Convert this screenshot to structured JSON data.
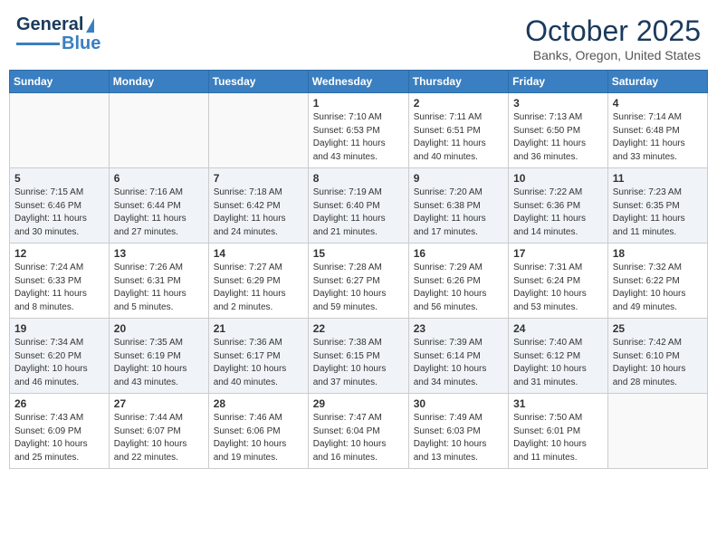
{
  "header": {
    "logo_line1": "General",
    "logo_line2": "Blue",
    "month": "October 2025",
    "location": "Banks, Oregon, United States"
  },
  "weekdays": [
    "Sunday",
    "Monday",
    "Tuesday",
    "Wednesday",
    "Thursday",
    "Friday",
    "Saturday"
  ],
  "weeks": [
    [
      {
        "day": "",
        "info": ""
      },
      {
        "day": "",
        "info": ""
      },
      {
        "day": "",
        "info": ""
      },
      {
        "day": "1",
        "info": "Sunrise: 7:10 AM\nSunset: 6:53 PM\nDaylight: 11 hours\nand 43 minutes."
      },
      {
        "day": "2",
        "info": "Sunrise: 7:11 AM\nSunset: 6:51 PM\nDaylight: 11 hours\nand 40 minutes."
      },
      {
        "day": "3",
        "info": "Sunrise: 7:13 AM\nSunset: 6:50 PM\nDaylight: 11 hours\nand 36 minutes."
      },
      {
        "day": "4",
        "info": "Sunrise: 7:14 AM\nSunset: 6:48 PM\nDaylight: 11 hours\nand 33 minutes."
      }
    ],
    [
      {
        "day": "5",
        "info": "Sunrise: 7:15 AM\nSunset: 6:46 PM\nDaylight: 11 hours\nand 30 minutes."
      },
      {
        "day": "6",
        "info": "Sunrise: 7:16 AM\nSunset: 6:44 PM\nDaylight: 11 hours\nand 27 minutes."
      },
      {
        "day": "7",
        "info": "Sunrise: 7:18 AM\nSunset: 6:42 PM\nDaylight: 11 hours\nand 24 minutes."
      },
      {
        "day": "8",
        "info": "Sunrise: 7:19 AM\nSunset: 6:40 PM\nDaylight: 11 hours\nand 21 minutes."
      },
      {
        "day": "9",
        "info": "Sunrise: 7:20 AM\nSunset: 6:38 PM\nDaylight: 11 hours\nand 17 minutes."
      },
      {
        "day": "10",
        "info": "Sunrise: 7:22 AM\nSunset: 6:36 PM\nDaylight: 11 hours\nand 14 minutes."
      },
      {
        "day": "11",
        "info": "Sunrise: 7:23 AM\nSunset: 6:35 PM\nDaylight: 11 hours\nand 11 minutes."
      }
    ],
    [
      {
        "day": "12",
        "info": "Sunrise: 7:24 AM\nSunset: 6:33 PM\nDaylight: 11 hours\nand 8 minutes."
      },
      {
        "day": "13",
        "info": "Sunrise: 7:26 AM\nSunset: 6:31 PM\nDaylight: 11 hours\nand 5 minutes."
      },
      {
        "day": "14",
        "info": "Sunrise: 7:27 AM\nSunset: 6:29 PM\nDaylight: 11 hours\nand 2 minutes."
      },
      {
        "day": "15",
        "info": "Sunrise: 7:28 AM\nSunset: 6:27 PM\nDaylight: 10 hours\nand 59 minutes."
      },
      {
        "day": "16",
        "info": "Sunrise: 7:29 AM\nSunset: 6:26 PM\nDaylight: 10 hours\nand 56 minutes."
      },
      {
        "day": "17",
        "info": "Sunrise: 7:31 AM\nSunset: 6:24 PM\nDaylight: 10 hours\nand 53 minutes."
      },
      {
        "day": "18",
        "info": "Sunrise: 7:32 AM\nSunset: 6:22 PM\nDaylight: 10 hours\nand 49 minutes."
      }
    ],
    [
      {
        "day": "19",
        "info": "Sunrise: 7:34 AM\nSunset: 6:20 PM\nDaylight: 10 hours\nand 46 minutes."
      },
      {
        "day": "20",
        "info": "Sunrise: 7:35 AM\nSunset: 6:19 PM\nDaylight: 10 hours\nand 43 minutes."
      },
      {
        "day": "21",
        "info": "Sunrise: 7:36 AM\nSunset: 6:17 PM\nDaylight: 10 hours\nand 40 minutes."
      },
      {
        "day": "22",
        "info": "Sunrise: 7:38 AM\nSunset: 6:15 PM\nDaylight: 10 hours\nand 37 minutes."
      },
      {
        "day": "23",
        "info": "Sunrise: 7:39 AM\nSunset: 6:14 PM\nDaylight: 10 hours\nand 34 minutes."
      },
      {
        "day": "24",
        "info": "Sunrise: 7:40 AM\nSunset: 6:12 PM\nDaylight: 10 hours\nand 31 minutes."
      },
      {
        "day": "25",
        "info": "Sunrise: 7:42 AM\nSunset: 6:10 PM\nDaylight: 10 hours\nand 28 minutes."
      }
    ],
    [
      {
        "day": "26",
        "info": "Sunrise: 7:43 AM\nSunset: 6:09 PM\nDaylight: 10 hours\nand 25 minutes."
      },
      {
        "day": "27",
        "info": "Sunrise: 7:44 AM\nSunset: 6:07 PM\nDaylight: 10 hours\nand 22 minutes."
      },
      {
        "day": "28",
        "info": "Sunrise: 7:46 AM\nSunset: 6:06 PM\nDaylight: 10 hours\nand 19 minutes."
      },
      {
        "day": "29",
        "info": "Sunrise: 7:47 AM\nSunset: 6:04 PM\nDaylight: 10 hours\nand 16 minutes."
      },
      {
        "day": "30",
        "info": "Sunrise: 7:49 AM\nSunset: 6:03 PM\nDaylight: 10 hours\nand 13 minutes."
      },
      {
        "day": "31",
        "info": "Sunrise: 7:50 AM\nSunset: 6:01 PM\nDaylight: 10 hours\nand 11 minutes."
      },
      {
        "day": "",
        "info": ""
      }
    ]
  ]
}
